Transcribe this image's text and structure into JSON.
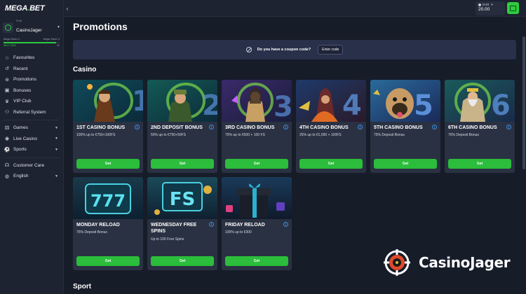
{
  "brand": {
    "logo_main": "MEGA",
    "logo_dot": ".",
    "logo_tail": "BET"
  },
  "profile": {
    "small_label": "Profil",
    "username": "CasinoJager",
    "level_current": "Mega Silver 2",
    "level_next": "Mega Silver 3",
    "points_current": "564.17/600",
    "points_next": "50",
    "level_progress": 0.94
  },
  "nav": {
    "favourites": "Favourites",
    "recent": "Recent",
    "promotions": "Promotions",
    "bonuses": "Bonuses",
    "vip_club": "VIP Club",
    "referral": "Referral System",
    "games": "Games",
    "live_casino": "Live Casino",
    "sports": "Sports",
    "customer_care": "Customer Care",
    "language": "English"
  },
  "wallet": {
    "currency": "EUR",
    "amount": "20.00"
  },
  "page": {
    "title": "Promotions"
  },
  "coupon": {
    "question": "Do you have a coupon code?",
    "button": "Enter code"
  },
  "sections": {
    "casino": "Casino",
    "sport": "Sport"
  },
  "cards": [
    {
      "title": "1ST CASINO BONUS",
      "desc": "100% up to €750+100FS",
      "button": "Get"
    },
    {
      "title": "2ND DEPOSIT BONUS",
      "desc": "50% up to €750+50FS",
      "button": "Get"
    },
    {
      "title": "3RD CASINO BONUS",
      "desc": "75% up to €500 + 100 FS",
      "button": "Get"
    },
    {
      "title": "4TH CASINO BONUS",
      "desc": "25% up to €1,000 + 100FS",
      "button": "Get"
    },
    {
      "title": "5TH CASINO BONUS",
      "desc": "75% Deposit Bonus",
      "button": "Get"
    },
    {
      "title": "6TH CASINO BONUS",
      "desc": "75% Deposit Bonus",
      "button": "Get"
    },
    {
      "title": "MONDAY RELOAD",
      "desc": "75% Deposit Bonus",
      "button": "Get"
    },
    {
      "title": "WEDNESDAY FREE SPINS",
      "desc": "Up to 100 Free Spins",
      "button": "Get"
    },
    {
      "title": "FRIDAY RELOAD",
      "desc": "100% up to €300",
      "button": "Get"
    }
  ],
  "card_images": {
    "img1_number": "1",
    "img2_number": "2",
    "img3_number": "3",
    "img4_number": "4",
    "img5_number": "5",
    "img6_number": "6",
    "img7_text": "777",
    "img8_text": "FS"
  },
  "watermark": {
    "text": "CasinoJager"
  },
  "colors": {
    "accent_green": "#2bbd3b",
    "background": "#171c29",
    "card": "#2a3142",
    "info_blue": "#3f8de0"
  }
}
